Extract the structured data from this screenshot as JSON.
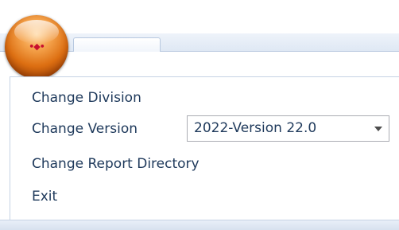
{
  "app": {
    "orb_glyph": "•◆•"
  },
  "menu": {
    "items": [
      {
        "label": "Change Division"
      },
      {
        "label": "Change Version"
      },
      {
        "label": "Change Report Directory"
      },
      {
        "label": "Exit"
      }
    ],
    "version_combo": {
      "value": "2022-Version 22.0"
    }
  },
  "colors": {
    "orb": "#dd6f12",
    "menu_text": "#1e395b",
    "ribbon": "#dfe8f4"
  },
  "icons": {
    "app_orb": "application-orb-icon",
    "dropdown": "chevron-down-icon"
  }
}
